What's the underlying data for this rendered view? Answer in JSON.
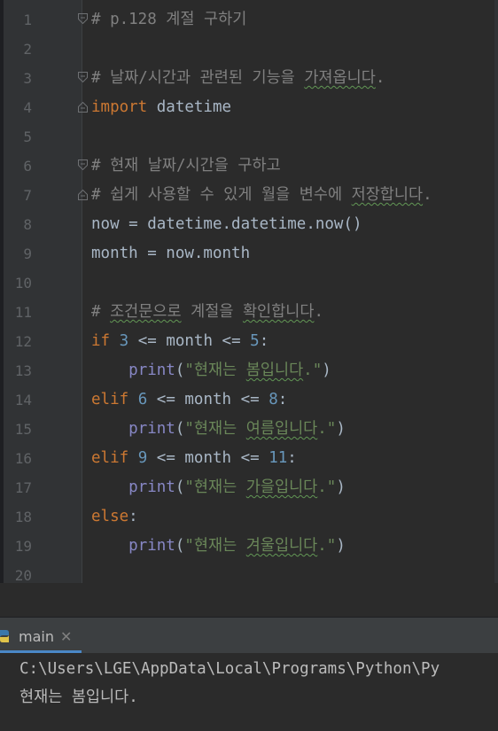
{
  "editor": {
    "line_numbers": [
      "1",
      "2",
      "3",
      "4",
      "5",
      "6",
      "7",
      "8",
      "9",
      "10",
      "11",
      "12",
      "13",
      "14",
      "15",
      "16",
      "17",
      "18",
      "19",
      "20"
    ],
    "lines": {
      "l1": {
        "comment": "# p.128 계절 구하기"
      },
      "l3": {
        "comment": "# 날짜/시간과 관련된 기능을 ",
        "comment_wavy": "가져옵니다",
        "comment_end": "."
      },
      "l4": {
        "kw": "import",
        "rest": " datetime"
      },
      "l6": {
        "comment": "# 현재 날짜/시간을 구하고"
      },
      "l7": {
        "comment": "# 쉽게 사용할 수 있게 월을 변수에 ",
        "comment_wavy": "저장합니다",
        "comment_end": "."
      },
      "l8": {
        "text": "now = datetime.datetime.now()"
      },
      "l9": {
        "text": "month = now.month"
      },
      "l11": {
        "hash": "# ",
        "comment_wavy": "조건문으로",
        "comment_mid": " 계절을 ",
        "comment_wavy2": "확인합니다",
        "comment_end": "."
      },
      "l12": {
        "kw": "if",
        "sp": " ",
        "num1": "3",
        "mid": " <= month <= ",
        "num2": "5",
        "end": ":"
      },
      "l13": {
        "indent": "    ",
        "fn": "print",
        "open": "(",
        "str_start": "\"현재는 ",
        "str_wavy": "봄입니다",
        "str_end": ".\"",
        "close": ")"
      },
      "l14": {
        "kw": "elif",
        "sp": " ",
        "num1": "6",
        "mid": " <= month <= ",
        "num2": "8",
        "end": ":"
      },
      "l15": {
        "indent": "    ",
        "fn": "print",
        "open": "(",
        "str_start": "\"현재는 ",
        "str_wavy": "여름입니다",
        "str_end": ".\"",
        "close": ")"
      },
      "l16": {
        "kw": "elif",
        "sp": " ",
        "num1": "9",
        "mid": " <= month <= ",
        "num2": "11",
        "end": ":"
      },
      "l17": {
        "indent": "    ",
        "fn": "print",
        "open": "(",
        "str_start": "\"현재는 ",
        "str_wavy": "가을입니다",
        "str_end": ".\"",
        "close": ")"
      },
      "l18": {
        "kw": "else",
        "end": ":"
      },
      "l19": {
        "indent": "    ",
        "fn": "print",
        "open": "(",
        "str_start": "\"현재는 ",
        "str_wavy": "겨울입니다",
        "str_end": ".\"",
        "close": ")"
      }
    }
  },
  "run_panel": {
    "tab_label": "main",
    "tab_close": "✕",
    "output": [
      "C:\\Users\\LGE\\AppData\\Local\\Programs\\Python\\Py",
      "현재는 봄입니다."
    ]
  },
  "colors": {
    "background": "#2b2b2b",
    "keyword": "#cc7832",
    "number": "#6897bb",
    "string": "#6a8759",
    "builtin": "#8888c6",
    "comment": "#808080",
    "line_number": "#606366"
  }
}
